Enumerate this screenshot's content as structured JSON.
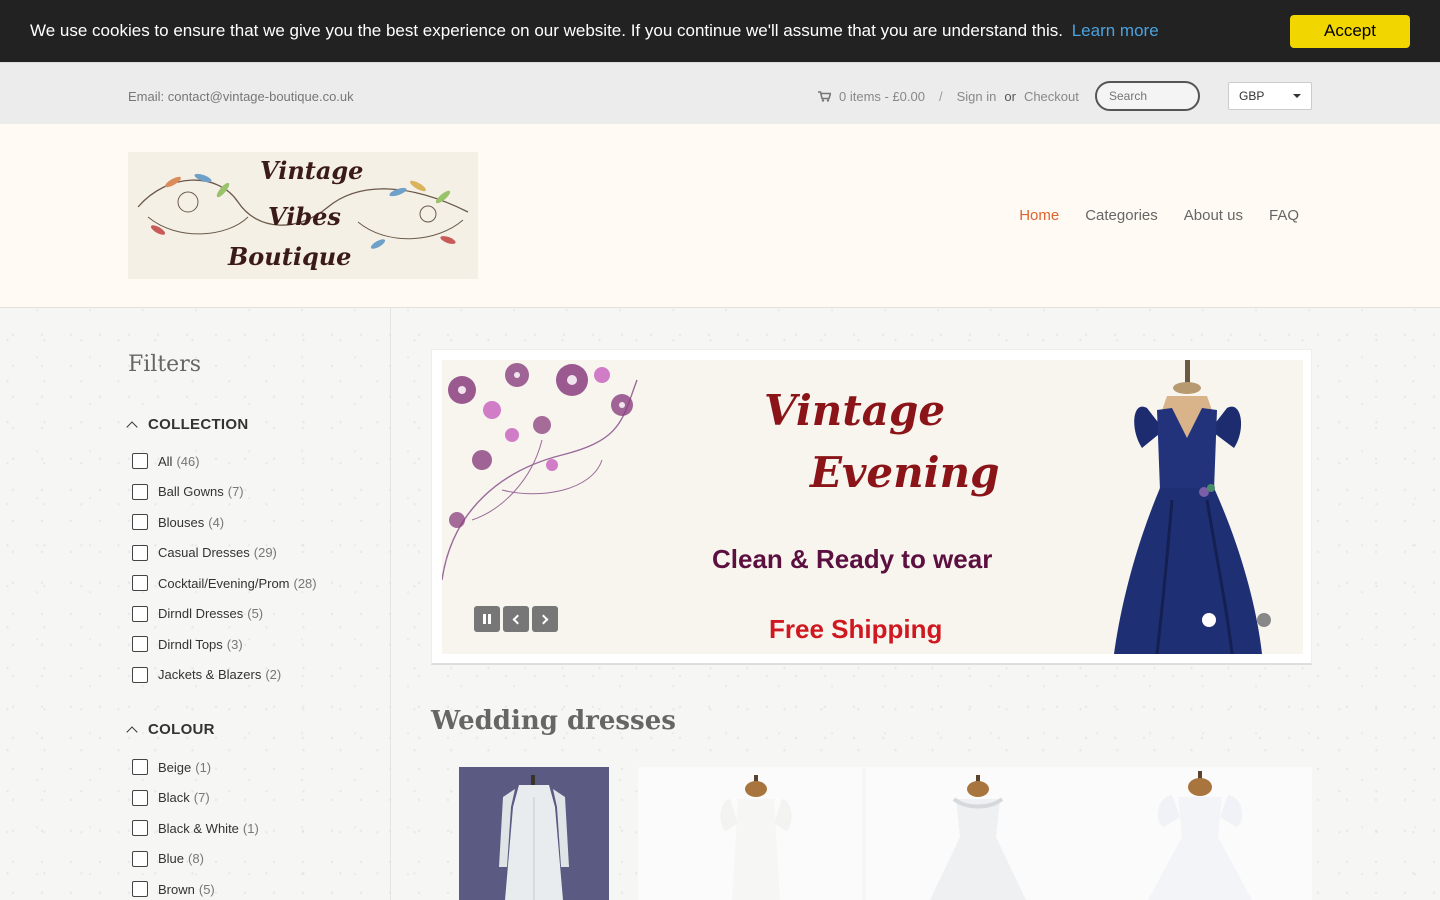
{
  "cookie": {
    "message": "We use cookies to ensure that we give you the best experience on our website. If you continue we'll assume that you are understand this.",
    "learn_more": "Learn more",
    "accept": "Accept"
  },
  "topbar": {
    "email": "Email: contact@vintage-boutique.co.uk",
    "cart": "0 items - £0.00",
    "separator": "/",
    "sign_in": "Sign in",
    "or": "or",
    "checkout": "Checkout",
    "search_placeholder": "Search",
    "currency": "GBP"
  },
  "logo": {
    "line1": "Vintage",
    "line2": "Vibes",
    "line3": "Boutique"
  },
  "nav": {
    "home": "Home",
    "categories": "Categories",
    "about": "About us",
    "faq": "FAQ"
  },
  "filters": {
    "title": "Filters",
    "collection": {
      "heading": "COLLECTION",
      "items": [
        {
          "label": "All",
          "count": "(46)"
        },
        {
          "label": "Ball Gowns",
          "count": "(7)"
        },
        {
          "label": "Blouses",
          "count": "(4)"
        },
        {
          "label": "Casual Dresses",
          "count": "(29)"
        },
        {
          "label": "Cocktail/Evening/Prom",
          "count": "(28)"
        },
        {
          "label": "Dirndl Dresses",
          "count": "(5)"
        },
        {
          "label": "Dirndl Tops",
          "count": "(3)"
        },
        {
          "label": "Jackets & Blazers",
          "count": "(2)"
        }
      ]
    },
    "colour": {
      "heading": "COLOUR",
      "items": [
        {
          "label": "Beige",
          "count": "(1)"
        },
        {
          "label": "Black",
          "count": "(7)"
        },
        {
          "label": "Black & White",
          "count": "(1)"
        },
        {
          "label": "Blue",
          "count": "(8)"
        },
        {
          "label": "Brown",
          "count": "(5)"
        }
      ]
    }
  },
  "slider": {
    "line1": "Vintage",
    "line2": "Evening",
    "line3": "Clean & Ready to wear",
    "line4": "Free Shipping",
    "active_dot": 1,
    "dot_count": 2
  },
  "section": {
    "title": "Wedding dresses"
  },
  "colors": {
    "accent": "#e0632e",
    "cookie_bg": "#222222",
    "accept_bg": "#f1d600",
    "learn_link": "#4aa3df"
  }
}
